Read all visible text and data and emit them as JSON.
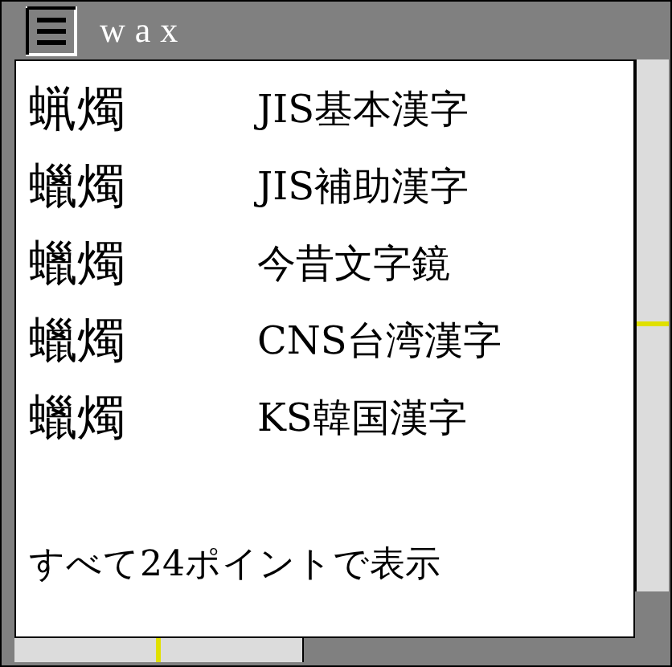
{
  "window": {
    "title": "wax"
  },
  "rows": [
    {
      "sample": "蝋燭",
      "label": "JIS基本漢字"
    },
    {
      "sample": "蠟燭",
      "label": "JIS補助漢字"
    },
    {
      "sample": "蠟燭",
      "label": "今昔文字鏡"
    },
    {
      "sample": "蠟燭",
      "label": "CNS台湾漢字"
    },
    {
      "sample": "蠟燭",
      "label": "KS韓国漢字"
    }
  ],
  "footer": "すべて24ポイントで表示"
}
